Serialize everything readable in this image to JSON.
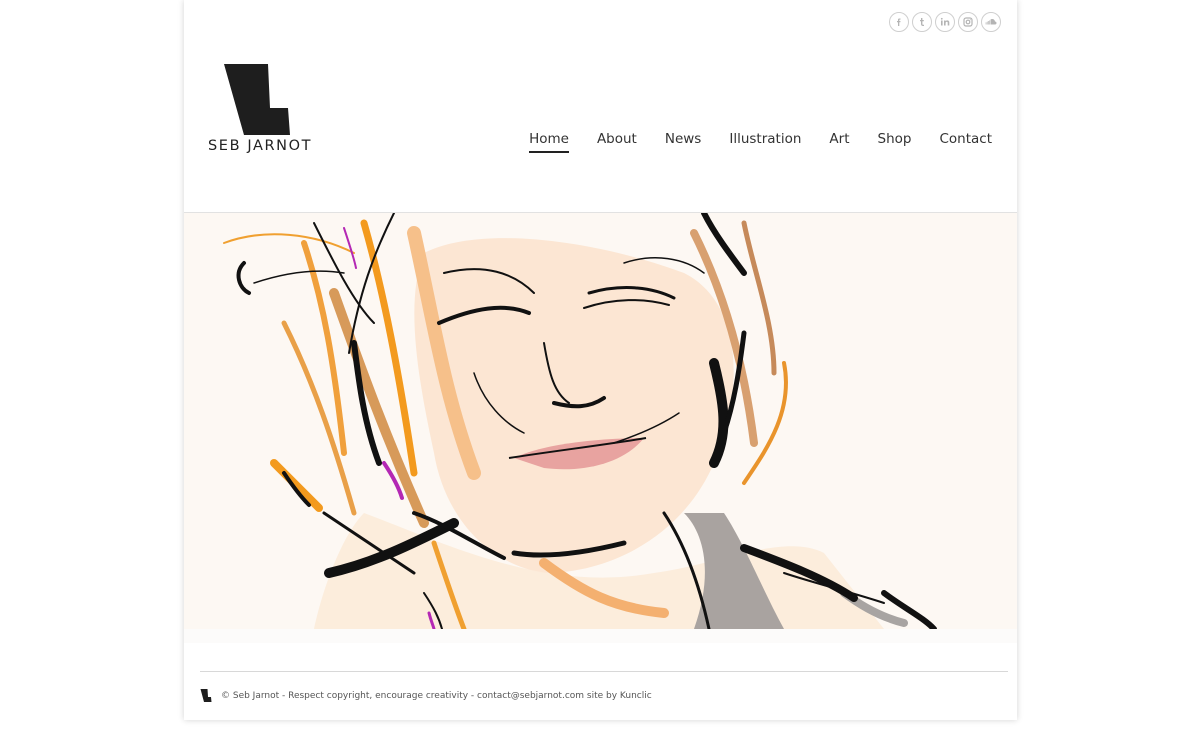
{
  "colors": {
    "accent": "#222222",
    "icon_border": "#cfcfcf",
    "hero_background": "#fdf8f3"
  },
  "social": [
    {
      "name": "facebook",
      "icon": "facebook-icon"
    },
    {
      "name": "tumblr",
      "icon": "tumblr-icon"
    },
    {
      "name": "linkedin",
      "icon": "linkedin-icon"
    },
    {
      "name": "instagram",
      "icon": "instagram-icon"
    },
    {
      "name": "soundcloud",
      "icon": "soundcloud-icon"
    }
  ],
  "logo": {
    "text": "SEB JARNOT"
  },
  "nav": {
    "items": [
      {
        "label": "Home",
        "active": true
      },
      {
        "label": "About",
        "active": false
      },
      {
        "label": "News",
        "active": false
      },
      {
        "label": "Illustration",
        "active": false
      },
      {
        "label": "Art",
        "active": false
      },
      {
        "label": "Shop",
        "active": false
      },
      {
        "label": "Contact",
        "active": false
      }
    ]
  },
  "hero": {
    "image": "self-portrait-illustration"
  },
  "footer": {
    "text": "© Seb Jarnot - Respect copyright, encourage creativity - contact@sebjarnot.com site by Kunclic"
  }
}
